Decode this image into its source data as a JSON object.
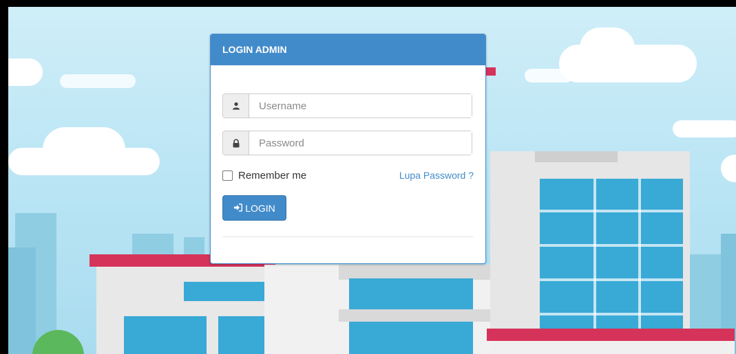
{
  "login": {
    "title": "LOGIN ADMIN",
    "username": {
      "placeholder": "Username",
      "icon": "user-icon"
    },
    "password": {
      "placeholder": "Password",
      "icon": "lock-icon"
    },
    "remember_label": "Remember me",
    "forgot_label": "Lupa Password ?",
    "submit_label": "LOGIN",
    "submit_icon": "sign-in-icon"
  },
  "colors": {
    "accent": "#428bca",
    "background_sky": "#b8e4f4"
  }
}
